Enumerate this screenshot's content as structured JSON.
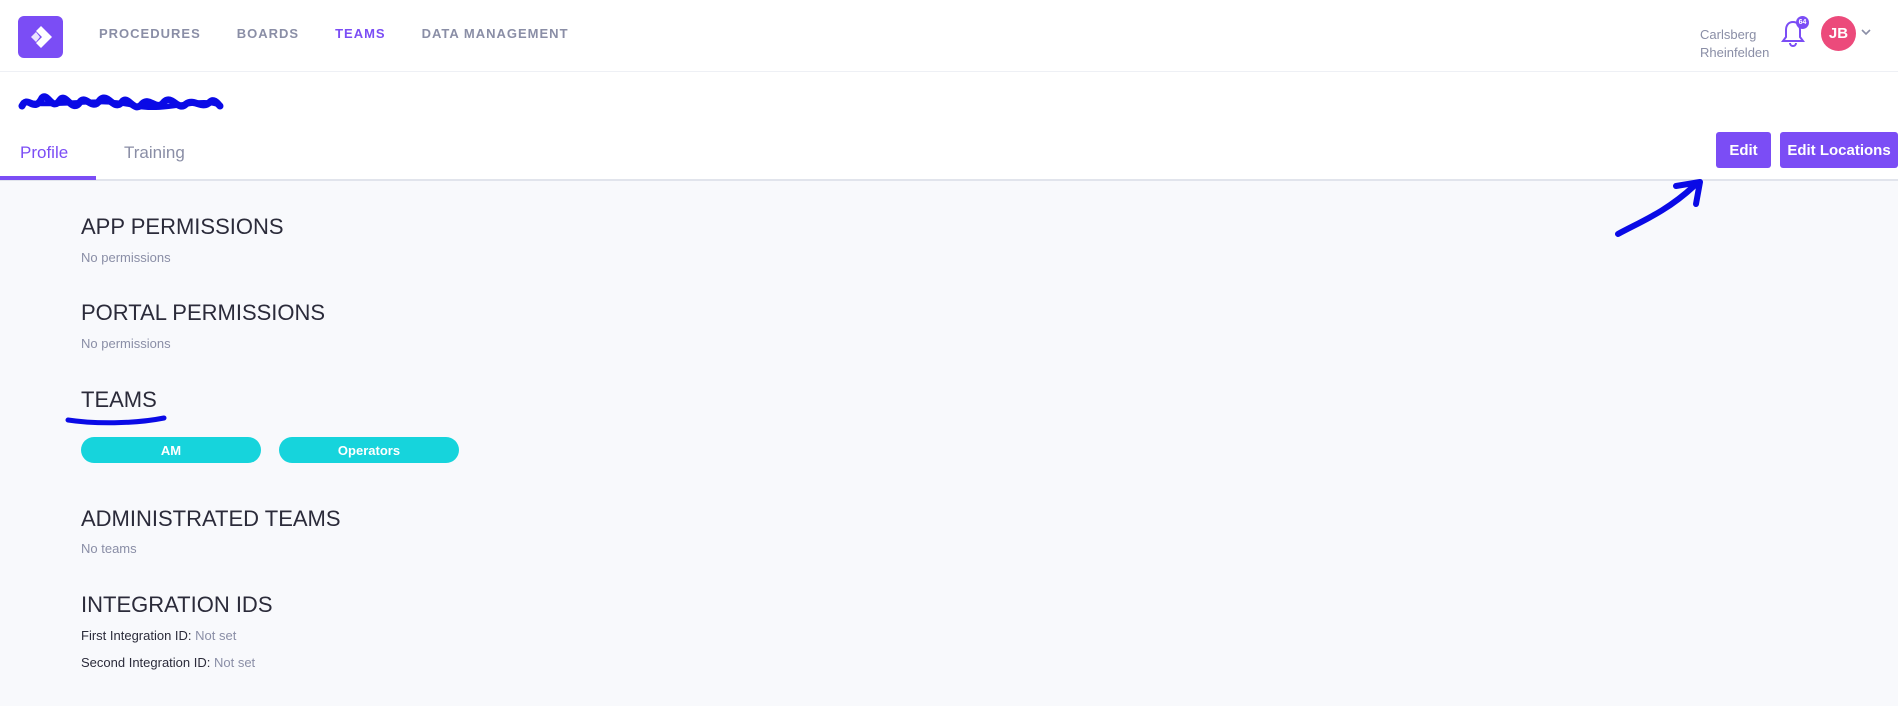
{
  "nav": {
    "items": [
      {
        "label": "PROCEDURES",
        "active": false
      },
      {
        "label": "BOARDS",
        "active": false
      },
      {
        "label": "TEAMS",
        "active": true
      },
      {
        "label": "DATA MANAGEMENT",
        "active": false
      }
    ]
  },
  "user": {
    "org_line1": "Carlsberg",
    "org_line2": "Rheinfelden",
    "notification_count": "64",
    "initials": "JB"
  },
  "tabs": {
    "profile": "Profile",
    "training": "Training"
  },
  "actions": {
    "edit": "Edit",
    "edit_locations": "Edit Locations"
  },
  "sections": {
    "app_permissions": {
      "title": "APP PERMISSIONS",
      "empty": "No permissions"
    },
    "portal_permissions": {
      "title": "PORTAL PERMISSIONS",
      "empty": "No permissions"
    },
    "teams": {
      "title": "TEAMS",
      "items": [
        "AM",
        "Operators"
      ]
    },
    "administrated_teams": {
      "title": "ADMINISTRATED TEAMS",
      "empty": "No teams"
    },
    "integration_ids": {
      "title": "INTEGRATION IDS",
      "first_label": "First Integration ID:",
      "first_value": "Not set",
      "second_label": "Second Integration ID:",
      "second_value": "Not set"
    }
  },
  "colors": {
    "accent": "#7b4df5",
    "team_chip": "#16d4dc",
    "avatar": "#ec4a7b",
    "annotation": "#0a0ae6"
  }
}
